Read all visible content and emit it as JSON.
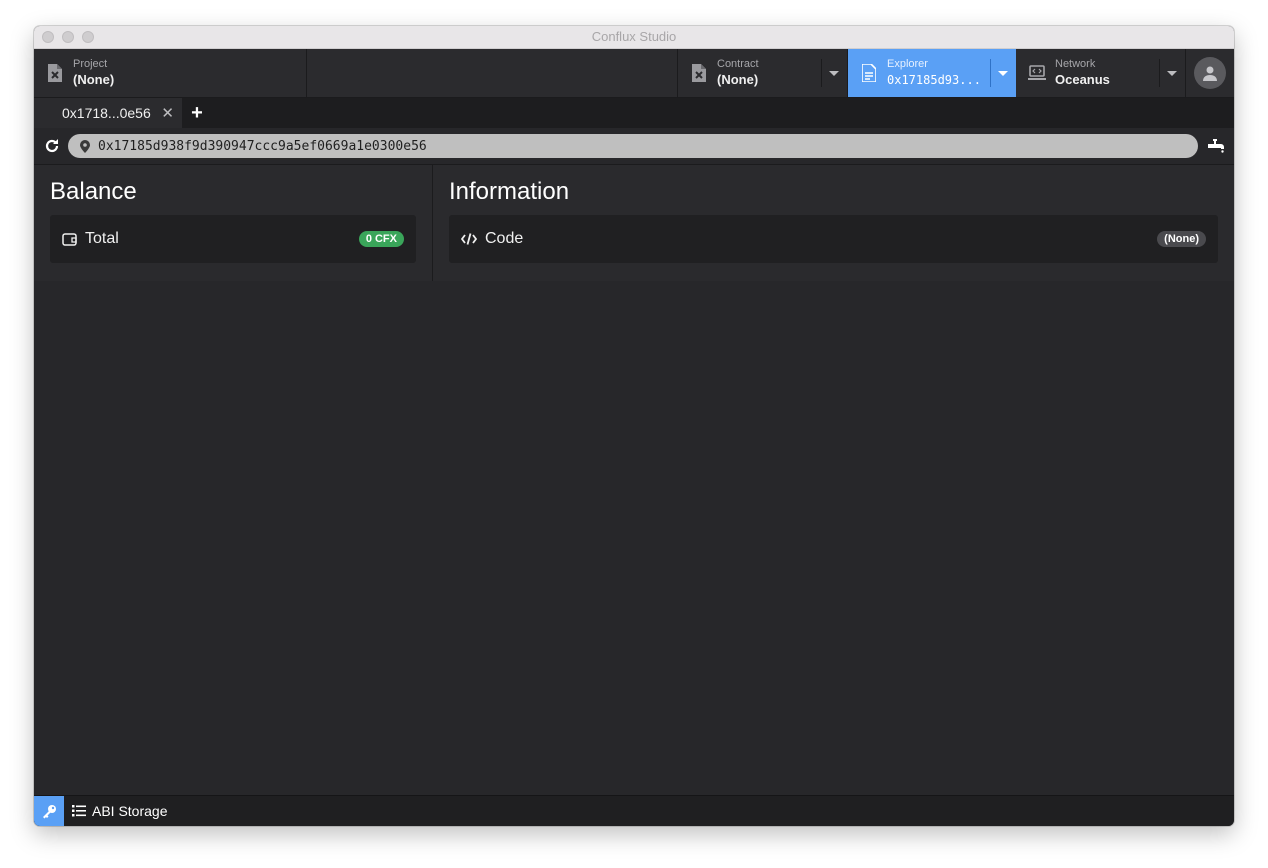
{
  "window": {
    "title": "Conflux Studio"
  },
  "navbar": {
    "project": {
      "label": "Project",
      "value": "(None)"
    },
    "contract": {
      "label": "Contract",
      "value": "(None)"
    },
    "explorer": {
      "label": "Explorer",
      "value": "0x17185d93..."
    },
    "network": {
      "label": "Network",
      "value": "Oceanus"
    }
  },
  "tabs": [
    {
      "label": "0x1718...0e56",
      "close": "✕"
    }
  ],
  "tab_add": "+",
  "address": {
    "value": "0x17185d938f9d390947ccc9a5ef0669a1e0300e56"
  },
  "balance": {
    "title": "Balance",
    "total_label": "Total",
    "total_value": "0 CFX"
  },
  "information": {
    "title": "Information",
    "code_label": "Code",
    "code_value": "(None)"
  },
  "statusbar": {
    "abi_label": "ABI Storage"
  },
  "colors": {
    "accent": "#5aa0f5",
    "badge_green": "#3aa55a",
    "background": "#27272a"
  }
}
